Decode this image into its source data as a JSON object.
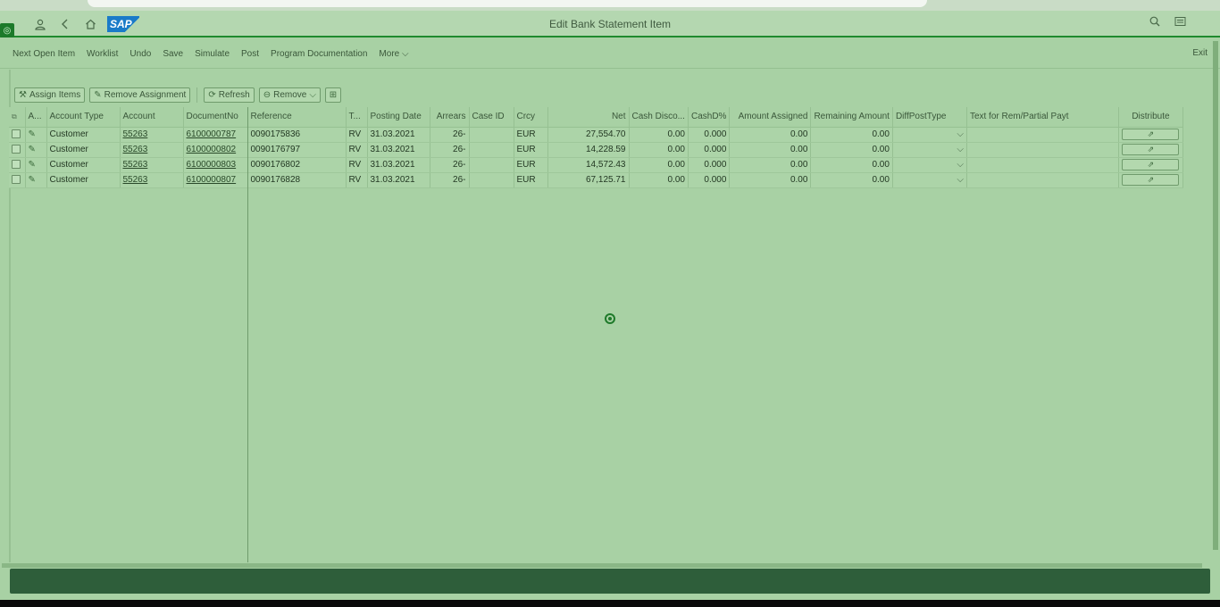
{
  "shell": {
    "title": "Edit Bank Statement Item",
    "logo": "SAP",
    "icons": [
      "user-icon",
      "back-icon",
      "home-icon",
      "search-icon",
      "menu-icon"
    ]
  },
  "toolbar": {
    "items": [
      "Next Open Item",
      "Worklist",
      "Undo",
      "Save",
      "Simulate",
      "Post",
      "Program Documentation",
      "More"
    ],
    "exit": "Exit"
  },
  "actions": {
    "assign_items": "Assign Items",
    "remove_assignment": "Remove Assignment",
    "refresh": "Refresh",
    "remove": "Remove"
  },
  "table": {
    "columns": [
      "",
      "A...",
      "Account Type",
      "Account",
      "DocumentNo",
      "Reference",
      "T...",
      "Posting Date",
      "Arrears",
      "Case ID",
      "Crcy",
      "Net",
      "Cash Disco...",
      "CashD%",
      "Amount Assigned",
      "Remaining Amount",
      "DiffPostType",
      "Text for Rem/Partial Payt",
      "Distribute"
    ],
    "rows": [
      {
        "account_type": "Customer",
        "account": "55263",
        "document_no": "6100000787",
        "reference": "0090175836",
        "type": "RV",
        "posting_date": "31.03.2021",
        "arrears": "26-",
        "case_id": "",
        "crcy": "EUR",
        "net": "27,554.70",
        "cash_disc": "0.00",
        "cashd_pct": "0.000",
        "amount_assigned": "0.00",
        "remaining_amount": "0.00",
        "diff_post_type": "",
        "text": ""
      },
      {
        "account_type": "Customer",
        "account": "55263",
        "document_no": "6100000802",
        "reference": "0090176797",
        "type": "RV",
        "posting_date": "31.03.2021",
        "arrears": "26-",
        "case_id": "",
        "crcy": "EUR",
        "net": "14,228.59",
        "cash_disc": "0.00",
        "cashd_pct": "0.000",
        "amount_assigned": "0.00",
        "remaining_amount": "0.00",
        "diff_post_type": "",
        "text": ""
      },
      {
        "account_type": "Customer",
        "account": "55263",
        "document_no": "6100000803",
        "reference": "0090176802",
        "type": "RV",
        "posting_date": "31.03.2021",
        "arrears": "26-",
        "case_id": "",
        "crcy": "EUR",
        "net": "14,572.43",
        "cash_disc": "0.00",
        "cashd_pct": "0.000",
        "amount_assigned": "0.00",
        "remaining_amount": "0.00",
        "diff_post_type": "",
        "text": ""
      },
      {
        "account_type": "Customer",
        "account": "55263",
        "document_no": "6100000807",
        "reference": "0090176828",
        "type": "RV",
        "posting_date": "31.03.2021",
        "arrears": "26-",
        "case_id": "",
        "crcy": "EUR",
        "net": "67,125.71",
        "cash_disc": "0.00",
        "cashd_pct": "0.000",
        "amount_assigned": "0.00",
        "remaining_amount": "0.00",
        "diff_post_type": "",
        "text": ""
      }
    ]
  }
}
